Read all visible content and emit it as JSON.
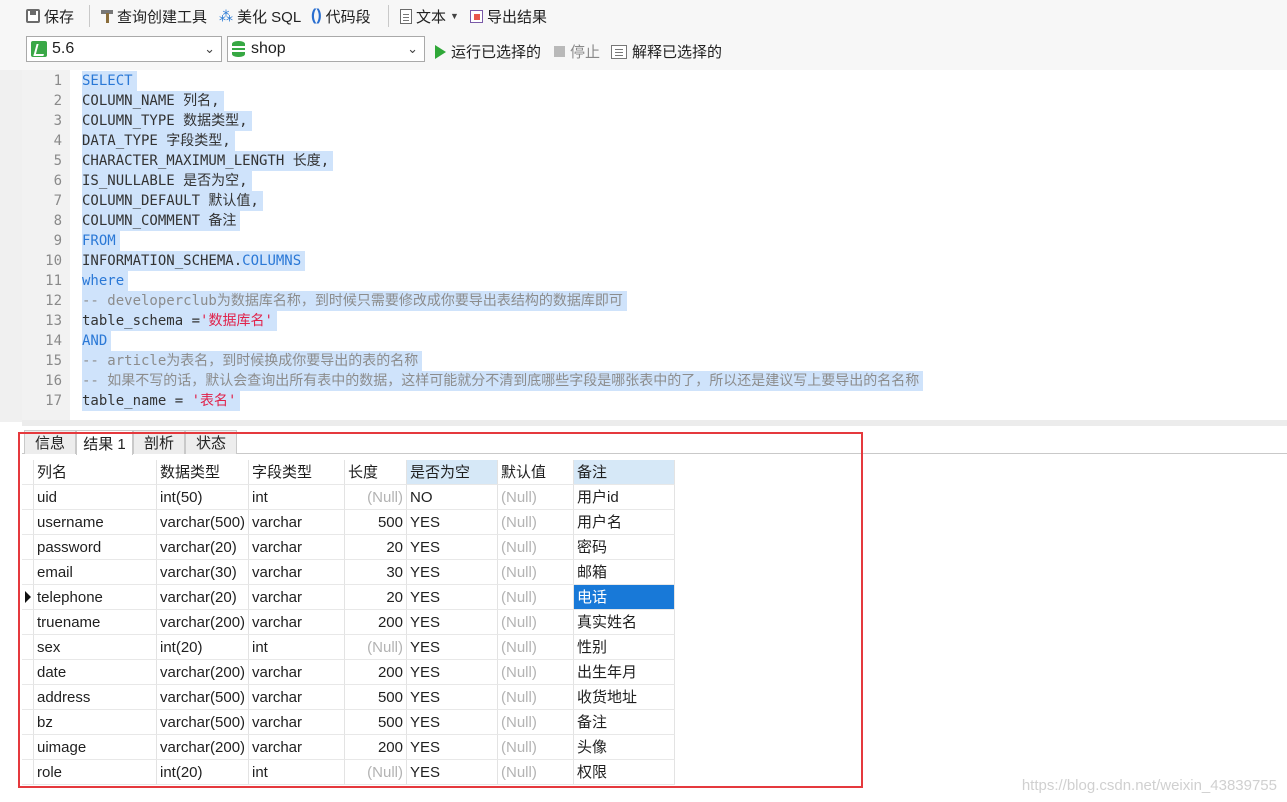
{
  "toolbar": {
    "save": "保存",
    "query_builder": "查询创建工具",
    "beautify": "美化 SQL",
    "snippet": "代码段",
    "text": "文本",
    "export": "导出结果"
  },
  "run_bar": {
    "connection": "5.6",
    "database": "shop",
    "run_selected": "运行已选择的",
    "stop": "停止",
    "explain_selected": "解释已选择的"
  },
  "editor": {
    "lines": [
      {
        "n": "1",
        "parts": [
          {
            "t": "SELECT",
            "k": "kw"
          }
        ]
      },
      {
        "n": "2",
        "parts": [
          {
            "t": "COLUMN_NAME 列名,",
            "k": ""
          }
        ]
      },
      {
        "n": "3",
        "parts": [
          {
            "t": "COLUMN_TYPE 数据类型,",
            "k": ""
          }
        ]
      },
      {
        "n": "4",
        "parts": [
          {
            "t": "DATA_TYPE 字段类型,",
            "k": ""
          }
        ]
      },
      {
        "n": "5",
        "parts": [
          {
            "t": "CHARACTER_MAXIMUM_LENGTH 长度,",
            "k": ""
          }
        ]
      },
      {
        "n": "6",
        "parts": [
          {
            "t": "IS_NULLABLE 是否为空,",
            "k": ""
          }
        ]
      },
      {
        "n": "7",
        "parts": [
          {
            "t": "COLUMN_DEFAULT 默认值,",
            "k": ""
          }
        ]
      },
      {
        "n": "8",
        "parts": [
          {
            "t": "COLUMN_COMMENT 备注",
            "k": ""
          }
        ]
      },
      {
        "n": "9",
        "parts": [
          {
            "t": "FROM",
            "k": "kw"
          }
        ]
      },
      {
        "n": "10",
        "parts": [
          {
            "t": "INFORMATION_SCHEMA.",
            "k": ""
          },
          {
            "t": "COLUMNS",
            "k": "kw"
          }
        ]
      },
      {
        "n": "11",
        "parts": [
          {
            "t": "where",
            "k": "kw"
          }
        ]
      },
      {
        "n": "12",
        "parts": [
          {
            "t": "-- developerclub为数据库名称，到时候只需要修改成你要导出表结构的数据库即可",
            "k": "cm"
          }
        ]
      },
      {
        "n": "13",
        "parts": [
          {
            "t": "table_schema =",
            "k": ""
          },
          {
            "t": "'数据库名'",
            "k": "str"
          }
        ]
      },
      {
        "n": "14",
        "parts": [
          {
            "t": "AND",
            "k": "kw"
          }
        ]
      },
      {
        "n": "15",
        "parts": [
          {
            "t": "-- article为表名，到时候换成你要导出的表的名称",
            "k": "cm"
          }
        ]
      },
      {
        "n": "16",
        "parts": [
          {
            "t": "-- 如果不写的话，默认会查询出所有表中的数据，这样可能就分不清到底哪些字段是哪张表中的了，所以还是建议写上要导出的名名称",
            "k": "cm"
          }
        ]
      },
      {
        "n": "17",
        "parts": [
          {
            "t": "table_name = ",
            "k": ""
          },
          {
            "t": "'表名'",
            "k": "str"
          }
        ]
      }
    ]
  },
  "result_tabs": [
    "信息",
    "结果 1",
    "剖析",
    "状态"
  ],
  "grid": {
    "headers": [
      "列名",
      "数据类型",
      "字段类型",
      "长度",
      "是否为空",
      "默认值",
      "备注"
    ],
    "rows": [
      [
        "uid",
        "int(50)",
        "int",
        "(Null)",
        "NO",
        "(Null)",
        "用户id"
      ],
      [
        "username",
        "varchar(500)",
        "varchar",
        "500",
        "YES",
        "(Null)",
        "用户名"
      ],
      [
        "password",
        "varchar(20)",
        "varchar",
        "20",
        "YES",
        "(Null)",
        "密码"
      ],
      [
        "email",
        "varchar(30)",
        "varchar",
        "30",
        "YES",
        "(Null)",
        "邮箱"
      ],
      [
        "telephone",
        "varchar(20)",
        "varchar",
        "20",
        "YES",
        "(Null)",
        "电话"
      ],
      [
        "truename",
        "varchar(200)",
        "varchar",
        "200",
        "YES",
        "(Null)",
        "真实姓名"
      ],
      [
        "sex",
        "int(20)",
        "int",
        "(Null)",
        "YES",
        "(Null)",
        "性别"
      ],
      [
        "date",
        "varchar(200)",
        "varchar",
        "200",
        "YES",
        "(Null)",
        "出生年月"
      ],
      [
        "address",
        "varchar(500)",
        "varchar",
        "500",
        "YES",
        "(Null)",
        "收货地址"
      ],
      [
        "bz",
        "varchar(500)",
        "varchar",
        "500",
        "YES",
        "(Null)",
        "备注"
      ],
      [
        "uimage",
        "varchar(200)",
        "varchar",
        "200",
        "YES",
        "(Null)",
        "头像"
      ],
      [
        "role",
        "int(20)",
        "int",
        "(Null)",
        "YES",
        "(Null)",
        "权限"
      ]
    ],
    "current_row": 4,
    "selected_column": 6
  },
  "watermark": "https://blog.csdn.net/weixin_43839755"
}
